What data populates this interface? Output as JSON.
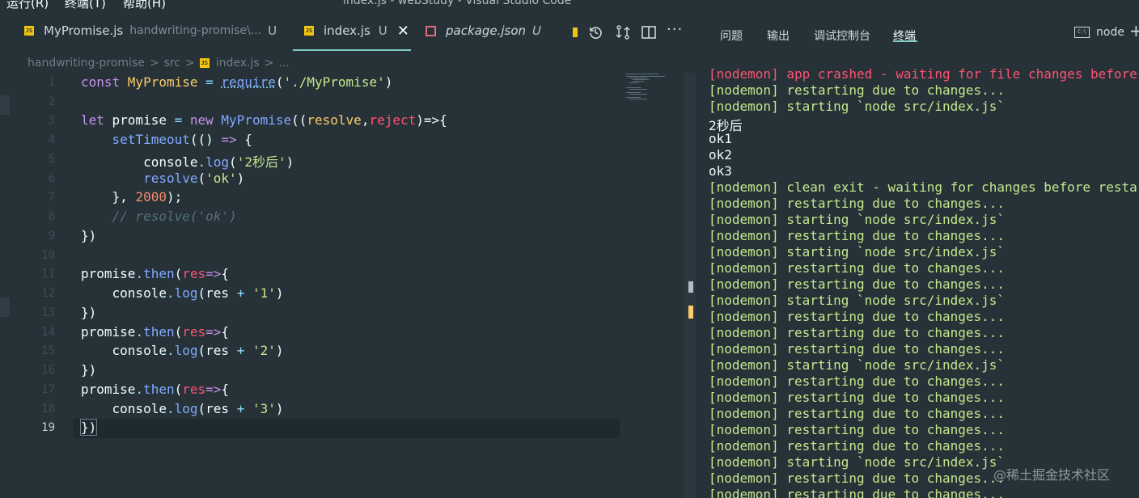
{
  "menu": [
    "运行(R)",
    "终端(T)",
    "帮助(H)"
  ],
  "window_title": "index.js - webStudy - Visual Studio Code",
  "tabs": [
    {
      "name": "MyPromise.js",
      "path": "handwriting-promise\\...",
      "status": "U",
      "icon": "js-file-icon"
    },
    {
      "name": "index.js",
      "status": "U",
      "icon": "js-file-icon",
      "active": true
    },
    {
      "name": "package.json",
      "status": "U",
      "icon": "json-file-icon",
      "italic": true
    }
  ],
  "toolbar_icons": [
    "history-icon",
    "compare-icon",
    "split-editor-icon",
    "more-icon"
  ],
  "breadcrumb": [
    "handwriting-promise",
    "src",
    "index.js",
    "..."
  ],
  "breadcrumb_sep": ">",
  "line_numbers": [
    "1",
    "2",
    "3",
    "4",
    "5",
    "6",
    "7",
    "8",
    "9",
    "10",
    "11",
    "12",
    "13",
    "14",
    "15",
    "16",
    "17",
    "18",
    "19"
  ],
  "code": {
    "l1": {
      "a": "const ",
      "b": "MyPromise",
      "c": " = ",
      "d": "require",
      "e": "(",
      "f": "'./MyPromise'",
      "g": ")"
    },
    "l3": {
      "a": "let ",
      "b": "promise",
      "c": " = ",
      "d": "new ",
      "e": "MyPromise",
      "f": "((",
      "g": "resolve",
      "h": ",",
      "i": "reject",
      "j": ")=>{"
    },
    "l4": {
      "a": "    ",
      "b": "setTimeout",
      "c": "(() ",
      "d": "=>",
      "e": " {"
    },
    "l5": {
      "a": "        console",
      "b": ".",
      "c": "log",
      "d": "(",
      "e": "'2秒后'",
      "f": ")"
    },
    "l6": {
      "a": "        ",
      "b": "resolve",
      "c": "(",
      "d": "'ok'",
      "e": ")"
    },
    "l7": {
      "a": "    }, ",
      "b": "2000",
      "c": ");"
    },
    "l8": {
      "a": "    ",
      "b": "// resolve('ok')"
    },
    "l9": {
      "a": "})"
    },
    "l11": {
      "a": "promise",
      "b": ".",
      "c": "then",
      "d": "(",
      "e": "res",
      "f": "=>",
      "g": "{"
    },
    "l12": {
      "a": "    console",
      "b": ".",
      "c": "log",
      "d": "(res ",
      "e": "+",
      "f": " ",
      "g": "'1'",
      "h": ")"
    },
    "l13": {
      "a": "})"
    },
    "l14": {
      "a": "promise",
      "b": ".",
      "c": "then",
      "d": "(",
      "e": "res",
      "f": "=>",
      "g": "{"
    },
    "l15": {
      "a": "    console",
      "b": ".",
      "c": "log",
      "d": "(res ",
      "e": "+",
      "f": " ",
      "g": "'2'",
      "h": ")"
    },
    "l16": {
      "a": "})"
    },
    "l17": {
      "a": "promise",
      "b": ".",
      "c": "then",
      "d": "(",
      "e": "res",
      "f": "=>",
      "g": "{"
    },
    "l18": {
      "a": "    console",
      "b": ".",
      "c": "log",
      "d": "(res ",
      "e": "+",
      "f": " ",
      "g": "'3'",
      "h": ")"
    },
    "l19": {
      "a": "})"
    }
  },
  "panel_tabs": [
    "问题",
    "输出",
    "调试控制台",
    "终端"
  ],
  "terminal_selector": {
    "icon_text": "C:\\",
    "label": "node"
  },
  "add_terminal_icon": "+",
  "terminal_lines": [
    {
      "text": "[nodemon] app crashed - waiting for file changes before starting...",
      "color": "red"
    },
    {
      "text": "[nodemon] restarting due to changes...",
      "color": "green"
    },
    {
      "text": "[nodemon] starting `node src/index.js`",
      "color": "green"
    },
    {
      "text": "2秒后",
      "color": "white"
    },
    {
      "text": "ok1",
      "color": "white"
    },
    {
      "text": "ok2",
      "color": "white"
    },
    {
      "text": "ok3",
      "color": "white"
    },
    {
      "text": "[nodemon] clean exit - waiting for changes before restart",
      "color": "green"
    },
    {
      "text": "[nodemon] restarting due to changes...",
      "color": "green"
    },
    {
      "text": "[nodemon] starting `node src/index.js`",
      "color": "green"
    },
    {
      "text": "[nodemon] restarting due to changes...",
      "color": "green"
    },
    {
      "text": "[nodemon] starting `node src/index.js`",
      "color": "green"
    },
    {
      "text": "[nodemon] restarting due to changes...",
      "color": "green"
    },
    {
      "text": "[nodemon] restarting due to changes...",
      "color": "green"
    },
    {
      "text": "[nodemon] starting `node src/index.js`",
      "color": "green"
    },
    {
      "text": "[nodemon] restarting due to changes...",
      "color": "green"
    },
    {
      "text": "[nodemon] restarting due to changes...",
      "color": "green"
    },
    {
      "text": "[nodemon] restarting due to changes...",
      "color": "green"
    },
    {
      "text": "[nodemon] starting `node src/index.js`",
      "color": "green"
    },
    {
      "text": "[nodemon] restarting due to changes...",
      "color": "green"
    },
    {
      "text": "[nodemon] restarting due to changes...",
      "color": "green"
    },
    {
      "text": "[nodemon] restarting due to changes...",
      "color": "green"
    },
    {
      "text": "[nodemon] restarting due to changes...",
      "color": "green"
    },
    {
      "text": "[nodemon] restarting due to changes...",
      "color": "green"
    },
    {
      "text": "[nodemon] starting `node src/index.js`",
      "color": "green"
    },
    {
      "text": "[nodemon] restarting due to changes...",
      "color": "green"
    },
    {
      "text": "[nodemon] restarting due to changes...",
      "color": "green"
    }
  ],
  "watermark": "@稀土掘金技术社区",
  "colors": {
    "background": "#263238",
    "accent": "#80cbc4",
    "terminal_error": "#ff5370",
    "terminal_info": "#c3e88d"
  }
}
